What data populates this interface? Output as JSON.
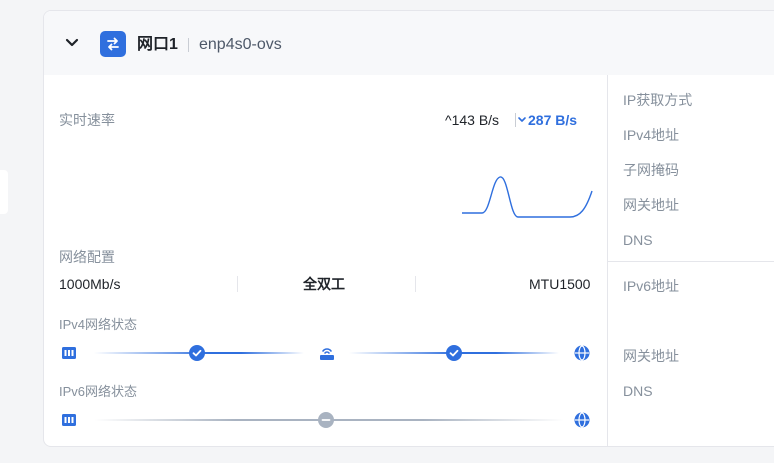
{
  "header": {
    "port_label": "网口1",
    "interface_name": "enp4s0-ovs"
  },
  "realtime": {
    "title": "实时速率",
    "upload": "^143 B/s",
    "download": "287 B/s"
  },
  "network_config": {
    "title": "网络配置",
    "speed": "1000Mb/s",
    "duplex": "全双工",
    "mtu": "MTU1500"
  },
  "ipv4_status": {
    "title": "IPv4网络状态"
  },
  "ipv6_status": {
    "title": "IPv6网络状态"
  },
  "details": {
    "ip_method_label": "IP获取方式",
    "ipv4_label": "IPv4地址",
    "subnet_label": "子网掩码",
    "gateway_label": "网关地址",
    "dns_label": "DNS",
    "ipv6_label": "IPv6地址",
    "gateway6_label": "网关地址",
    "dns6_label": "DNS"
  },
  "colors": {
    "accent": "#2f6fde",
    "muted_text": "#86909c",
    "inactive": "#a9b3c1"
  }
}
